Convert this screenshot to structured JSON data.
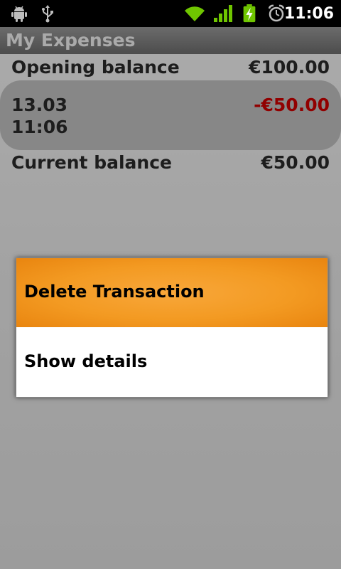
{
  "status_bar": {
    "time": "11:06",
    "icons": [
      "android-debug-icon",
      "usb-icon",
      "wifi-icon",
      "signal-icon",
      "battery-charging-icon",
      "alarm-icon"
    ],
    "battery_color": "#6fc500",
    "signal_color": "#6fc500"
  },
  "app": {
    "title": "My Expenses"
  },
  "balances": {
    "opening_label": "Opening balance",
    "opening_value": "€100.00",
    "current_label": "Current balance",
    "current_value": "€50.00"
  },
  "transactions": [
    {
      "date": "13.03",
      "time": "11:06",
      "amount": "-€50.00",
      "amount_color": "#d00000"
    }
  ],
  "context_menu": {
    "items": [
      {
        "label": "Delete Transaction",
        "selected": true
      },
      {
        "label": "Show details",
        "selected": false
      }
    ],
    "accent": "#f39a22"
  }
}
